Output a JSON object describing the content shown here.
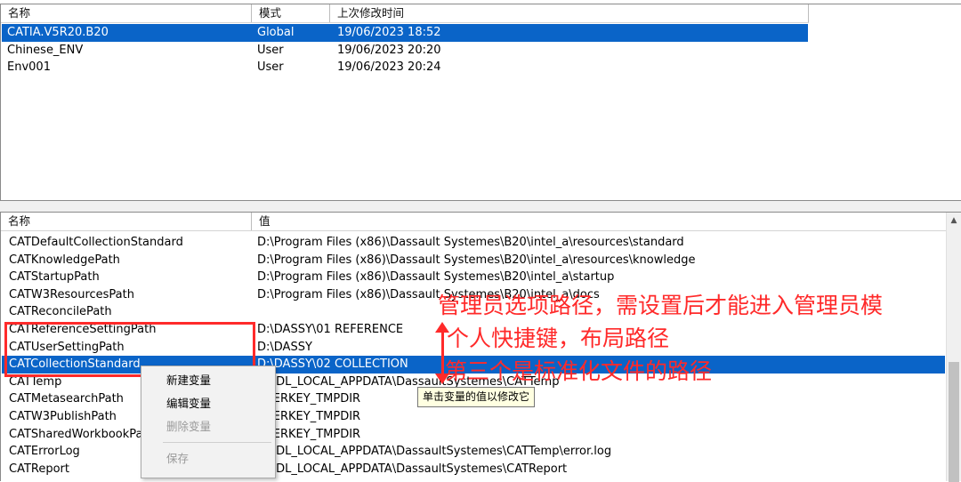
{
  "top_table": {
    "headers": [
      "名称",
      "模式",
      "上次修改时间"
    ],
    "rows": [
      {
        "name": "CATIA.V5R20.B20",
        "mode": "Global",
        "date": "19/06/2023  18:52",
        "selected": true
      },
      {
        "name": "Chinese_ENV",
        "mode": "User",
        "date": "19/06/2023  20:20",
        "selected": false
      },
      {
        "name": "Env001",
        "mode": "User",
        "date": "19/06/2023  20:24",
        "selected": false
      }
    ]
  },
  "bottom_table": {
    "headers": [
      "名称",
      "值"
    ],
    "rows": [
      {
        "name": "CATDefaultCollectionStandard",
        "value": "D:\\Program Files (x86)\\Dassault Systemes\\B20\\intel_a\\resources\\standard"
      },
      {
        "name": "CATKnowledgePath",
        "value": "D:\\Program Files (x86)\\Dassault Systemes\\B20\\intel_a\\resources\\knowledge"
      },
      {
        "name": "CATStartupPath",
        "value": "D:\\Program Files (x86)\\Dassault Systemes\\B20\\intel_a\\startup"
      },
      {
        "name": "CATW3ResourcesPath",
        "value": "D:\\Program Files (x86)\\Dassault Systemes\\B20\\intel_a\\docs"
      },
      {
        "name": "CATReconcilePath",
        "value": ""
      },
      {
        "name": "CATReferenceSettingPath",
        "value": "D:\\DASSY\\01 REFERENCE"
      },
      {
        "name": "CATUserSettingPath",
        "value": "D:\\DASSY"
      },
      {
        "name": "CATCollectionStandard",
        "value": "D:\\DASSY\\02 COLLECTION"
      },
      {
        "name": "CATTemp",
        "value": "CSIDL_LOCAL_APPDATA\\DassaultSystemes\\CATTemp"
      },
      {
        "name": "CATMetasearchPath",
        "value": "USERKEY_TMPDIR"
      },
      {
        "name": "CATW3PublishPath",
        "value": "USERKEY_TMPDIR"
      },
      {
        "name": "CATSharedWorkbookPath",
        "value": "USERKEY_TMPDIR"
      },
      {
        "name": "CATErrorLog",
        "value": "CSIDL_LOCAL_APPDATA\\DassaultSystemes\\CATTemp\\error.log"
      },
      {
        "name": "CATReport",
        "value": "CSIDL_LOCAL_APPDATA\\DassaultSystemes\\CATReport"
      }
    ]
  },
  "context_menu": {
    "items": [
      {
        "label": "新建变量",
        "disabled": false
      },
      {
        "label": "编辑变量",
        "disabled": false
      },
      {
        "label": "删除变量",
        "disabled": true
      },
      {
        "label": "保存",
        "disabled": true
      }
    ]
  },
  "tooltip": "单击变量的值以修改它",
  "annotations": {
    "line1": "管理员选项路径，需设置后才能进入管理员模",
    "line2": "个人快捷键，布局路径",
    "line3": "第三个是标准化文件的路径",
    "color": "#ff2a2a"
  },
  "colors": {
    "selection": "#0a64c8"
  }
}
